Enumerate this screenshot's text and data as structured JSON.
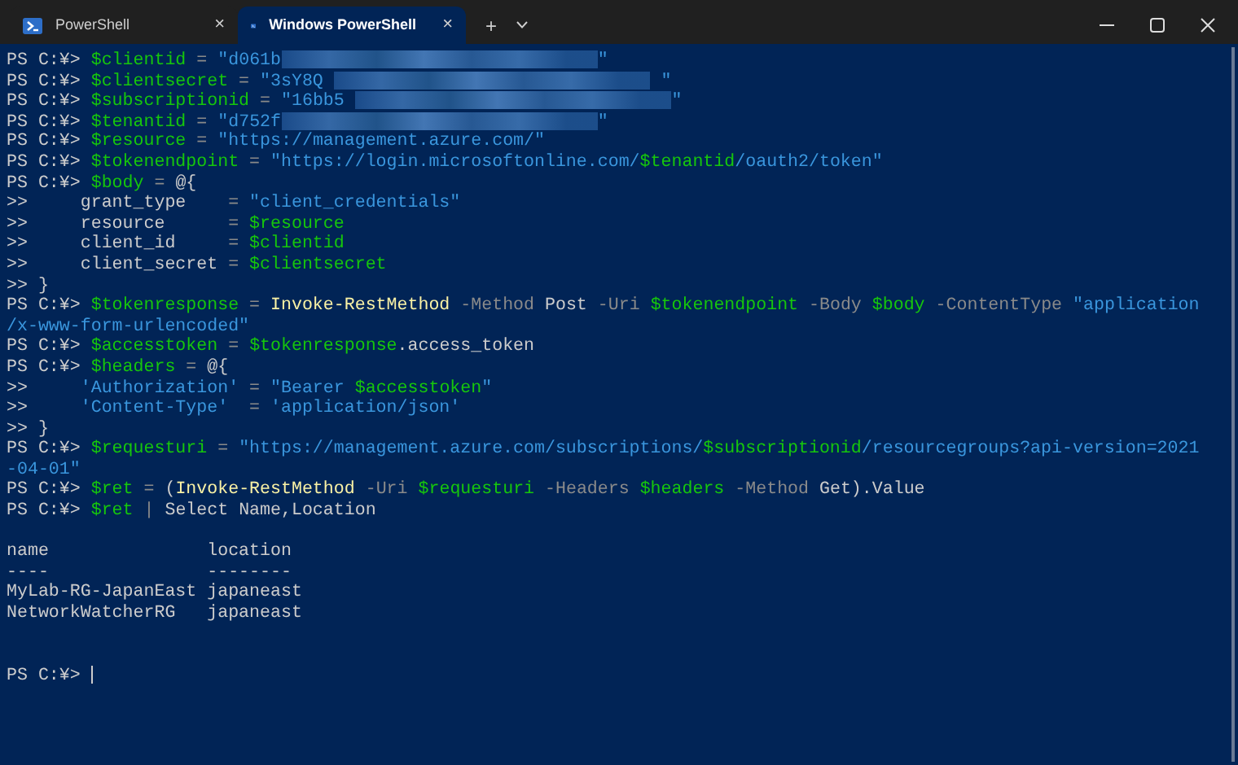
{
  "tabs": [
    {
      "label": "PowerShell",
      "selected": false,
      "close": "×"
    },
    {
      "label": "Windows PowerShell",
      "selected": true,
      "close": "×"
    }
  ],
  "new_tab": "+",
  "terminal": {
    "lines": [
      {
        "kind": "line",
        "segments": [
          {
            "kind": "plain",
            "text": "PS C:¥> "
          },
          {
            "kind": "var",
            "text": "$clientid"
          },
          {
            "kind": "op",
            "text": " = "
          },
          {
            "kind": "str",
            "text": "\"d061b"
          },
          {
            "kind": "redacted"
          },
          {
            "kind": "str",
            "text": "\""
          }
        ]
      },
      {
        "kind": "line",
        "segments": [
          {
            "kind": "plain",
            "text": "PS C:¥> "
          },
          {
            "kind": "var",
            "text": "$clientsecret"
          },
          {
            "kind": "op",
            "text": " = "
          },
          {
            "kind": "str",
            "text": "\"3sY8Q "
          },
          {
            "kind": "redacted"
          },
          {
            "kind": "str",
            "text": " \""
          }
        ]
      },
      {
        "kind": "line",
        "segments": [
          {
            "kind": "plain",
            "text": "PS C:¥> "
          },
          {
            "kind": "var",
            "text": "$subscriptionid"
          },
          {
            "kind": "op",
            "text": " = "
          },
          {
            "kind": "str",
            "text": "\"16bb5 "
          },
          {
            "kind": "redacted"
          },
          {
            "kind": "str",
            "text": "\""
          }
        ]
      },
      {
        "kind": "line",
        "segments": [
          {
            "kind": "plain",
            "text": "PS C:¥> "
          },
          {
            "kind": "var",
            "text": "$tenantid"
          },
          {
            "kind": "op",
            "text": " = "
          },
          {
            "kind": "str",
            "text": "\"d752f"
          },
          {
            "kind": "redacted"
          },
          {
            "kind": "str",
            "text": "\""
          }
        ]
      },
      {
        "kind": "line",
        "segments": [
          {
            "kind": "plain",
            "text": "PS C:¥> "
          },
          {
            "kind": "var",
            "text": "$resource"
          },
          {
            "kind": "op",
            "text": " = "
          },
          {
            "kind": "str",
            "text": "\"https://management.azure.com/\""
          }
        ]
      },
      {
        "kind": "line",
        "segments": [
          {
            "kind": "plain",
            "text": "PS C:¥> "
          },
          {
            "kind": "var",
            "text": "$tokenendpoint"
          },
          {
            "kind": "op",
            "text": " = "
          },
          {
            "kind": "str",
            "text": "\"https://login.microsoftonline.com/"
          },
          {
            "kind": "var",
            "text": "$tenantid"
          },
          {
            "kind": "str",
            "text": "/oauth2/token\""
          }
        ]
      },
      {
        "kind": "line",
        "segments": [
          {
            "kind": "plain",
            "text": "PS C:¥> "
          },
          {
            "kind": "var",
            "text": "$body"
          },
          {
            "kind": "op",
            "text": " = "
          },
          {
            "kind": "plain",
            "text": "@{"
          }
        ]
      },
      {
        "kind": "line",
        "segments": [
          {
            "kind": "plain",
            "text": ">>     grant_type    "
          },
          {
            "kind": "op",
            "text": "= "
          },
          {
            "kind": "str",
            "text": "\"client_credentials\""
          }
        ]
      },
      {
        "kind": "line",
        "segments": [
          {
            "kind": "plain",
            "text": ">>     resource      "
          },
          {
            "kind": "op",
            "text": "= "
          },
          {
            "kind": "var",
            "text": "$resource"
          }
        ]
      },
      {
        "kind": "line",
        "segments": [
          {
            "kind": "plain",
            "text": ">>     client_id     "
          },
          {
            "kind": "op",
            "text": "= "
          },
          {
            "kind": "var",
            "text": "$clientid"
          }
        ]
      },
      {
        "kind": "line",
        "segments": [
          {
            "kind": "plain",
            "text": ">>     client_secret "
          },
          {
            "kind": "op",
            "text": "= "
          },
          {
            "kind": "var",
            "text": "$clientsecret"
          }
        ]
      },
      {
        "kind": "line",
        "segments": [
          {
            "kind": "plain",
            "text": ">> }"
          }
        ]
      },
      {
        "kind": "line",
        "segments": [
          {
            "kind": "plain",
            "text": "PS C:¥> "
          },
          {
            "kind": "var",
            "text": "$tokenresponse"
          },
          {
            "kind": "op",
            "text": " = "
          },
          {
            "kind": "cmd",
            "text": "Invoke-RestMethod"
          },
          {
            "kind": "param",
            "text": " -Method"
          },
          {
            "kind": "plain",
            "text": " Post"
          },
          {
            "kind": "param",
            "text": " -Uri "
          },
          {
            "kind": "var",
            "text": "$tokenendpoint"
          },
          {
            "kind": "param",
            "text": " -Body "
          },
          {
            "kind": "var",
            "text": "$body"
          },
          {
            "kind": "param",
            "text": " -ContentType "
          },
          {
            "kind": "str",
            "text": "\"application"
          }
        ]
      },
      {
        "kind": "line",
        "segments": [
          {
            "kind": "str",
            "text": "/x-www-form-urlencoded\""
          }
        ]
      },
      {
        "kind": "line",
        "segments": [
          {
            "kind": "plain",
            "text": "PS C:¥> "
          },
          {
            "kind": "var",
            "text": "$accesstoken"
          },
          {
            "kind": "op",
            "text": " = "
          },
          {
            "kind": "var",
            "text": "$tokenresponse"
          },
          {
            "kind": "plain",
            "text": ".access_token"
          }
        ]
      },
      {
        "kind": "line",
        "segments": [
          {
            "kind": "plain",
            "text": "PS C:¥> "
          },
          {
            "kind": "var",
            "text": "$headers"
          },
          {
            "kind": "op",
            "text": " = "
          },
          {
            "kind": "plain",
            "text": "@{"
          }
        ]
      },
      {
        "kind": "line",
        "segments": [
          {
            "kind": "plain",
            "text": ">>     "
          },
          {
            "kind": "str",
            "text": "'Authorization'"
          },
          {
            "kind": "op",
            "text": " = "
          },
          {
            "kind": "str",
            "text": "\"Bearer "
          },
          {
            "kind": "var",
            "text": "$accesstoken"
          },
          {
            "kind": "str",
            "text": "\""
          }
        ]
      },
      {
        "kind": "line",
        "segments": [
          {
            "kind": "plain",
            "text": ">>     "
          },
          {
            "kind": "str",
            "text": "'Content-Type'"
          },
          {
            "kind": "op",
            "text": "  = "
          },
          {
            "kind": "str",
            "text": "'application/json'"
          }
        ]
      },
      {
        "kind": "line",
        "segments": [
          {
            "kind": "plain",
            "text": ">> }"
          }
        ]
      },
      {
        "kind": "line",
        "segments": [
          {
            "kind": "plain",
            "text": "PS C:¥> "
          },
          {
            "kind": "var",
            "text": "$requesturi"
          },
          {
            "kind": "op",
            "text": " = "
          },
          {
            "kind": "str",
            "text": "\"https://management.azure.com/subscriptions/"
          },
          {
            "kind": "var",
            "text": "$subscriptionid"
          },
          {
            "kind": "str",
            "text": "/resourcegroups?api-version=2021"
          }
        ]
      },
      {
        "kind": "line",
        "segments": [
          {
            "kind": "str",
            "text": "-04-01\""
          }
        ]
      },
      {
        "kind": "line",
        "segments": [
          {
            "kind": "plain",
            "text": "PS C:¥> "
          },
          {
            "kind": "var",
            "text": "$ret"
          },
          {
            "kind": "op",
            "text": " = "
          },
          {
            "kind": "plain",
            "text": "("
          },
          {
            "kind": "cmd",
            "text": "Invoke-RestMethod"
          },
          {
            "kind": "param",
            "text": " -Uri "
          },
          {
            "kind": "var",
            "text": "$requesturi"
          },
          {
            "kind": "param",
            "text": " -Headers "
          },
          {
            "kind": "var",
            "text": "$headers"
          },
          {
            "kind": "param",
            "text": " -Method"
          },
          {
            "kind": "plain",
            "text": " Get).Value"
          }
        ]
      },
      {
        "kind": "line",
        "segments": [
          {
            "kind": "plain",
            "text": "PS C:¥> "
          },
          {
            "kind": "var",
            "text": "$ret"
          },
          {
            "kind": "op",
            "text": " | "
          },
          {
            "kind": "plain",
            "text": "Select Name,Location"
          }
        ]
      },
      {
        "kind": "blank"
      },
      {
        "kind": "line",
        "segments": [
          {
            "kind": "plain",
            "text": "name               location"
          }
        ]
      },
      {
        "kind": "line",
        "segments": [
          {
            "kind": "plain",
            "text": "----               --------"
          }
        ]
      },
      {
        "kind": "line",
        "segments": [
          {
            "kind": "plain",
            "text": "MyLab-RG-JapanEast japaneast"
          }
        ]
      },
      {
        "kind": "line",
        "segments": [
          {
            "kind": "plain",
            "text": "NetworkWatcherRG   japaneast"
          }
        ]
      },
      {
        "kind": "blank"
      },
      {
        "kind": "blank"
      },
      {
        "kind": "line",
        "segments": [
          {
            "kind": "plain",
            "text": "PS C:¥> "
          },
          {
            "kind": "cursor"
          }
        ]
      }
    ]
  }
}
